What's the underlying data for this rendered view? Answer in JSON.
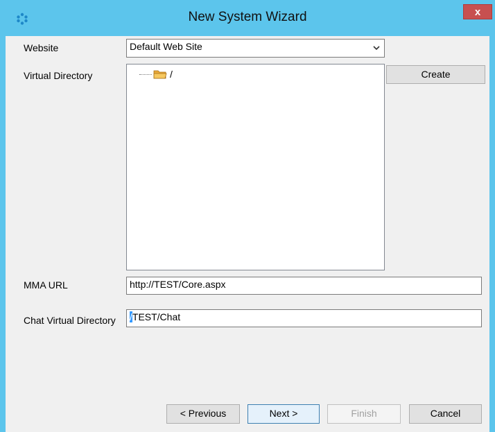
{
  "window": {
    "title": "New System Wizard",
    "close_label": "x"
  },
  "form": {
    "website_label": "Website",
    "website_value": "Default Web Site",
    "virtual_directory_label": "Virtual Directory",
    "tree_root": "/",
    "create_label": "Create",
    "mma_url_label": "MMA URL",
    "mma_url_value": "http://TEST/Core.aspx",
    "chat_vdir_label": "Chat Virtual Directory",
    "chat_vdir_selected": "/",
    "chat_vdir_rest": "TEST/Chat"
  },
  "buttons": {
    "previous": "< Previous",
    "next": "Next >",
    "finish": "Finish",
    "cancel": "Cancel"
  },
  "colors": {
    "titlebar": "#5cc5ec",
    "close": "#c75050",
    "selection": "#3399ff"
  }
}
